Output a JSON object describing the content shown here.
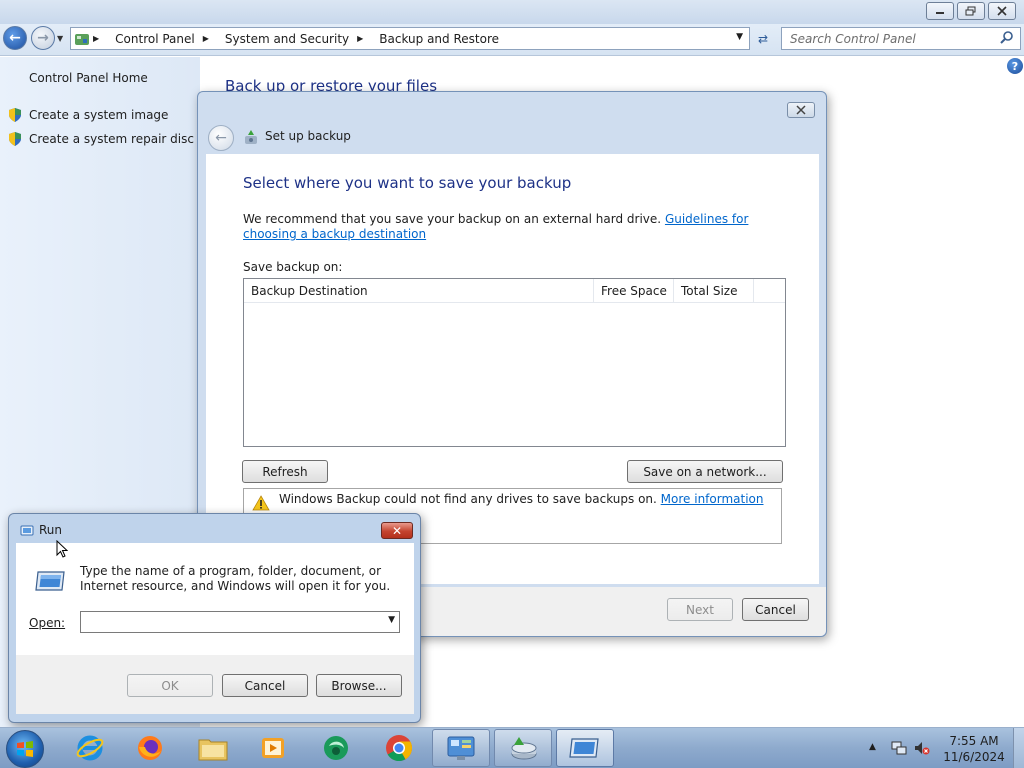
{
  "control_panel": {
    "breadcrumbs": [
      "Control Panel",
      "System and Security",
      "Backup and Restore"
    ],
    "search_placeholder": "Search Control Panel",
    "left_nav": {
      "home": "Control Panel Home",
      "items": [
        "Create a system image",
        "Create a system repair disc"
      ]
    },
    "heading": "Back up or restore your files",
    "caption_buttons": [
      "minimize",
      "restore",
      "close"
    ]
  },
  "backup_dialog": {
    "title": "Set up backup",
    "instruction": "Select where you want to save your backup",
    "recommendation": "We recommend that you save your backup on an external hard drive.",
    "guidelines_link": "Guidelines for choosing a backup destination",
    "save_on_label": "Save backup on:",
    "columns": [
      "Backup Destination",
      "Free Space",
      "Total Size"
    ],
    "rows": [],
    "refresh_button": "Refresh",
    "save_network_button": "Save on a network...",
    "warning_text": "Windows Backup could not find any drives to save backups on.",
    "more_info_link": "More information",
    "next_button": "Next",
    "cancel_button": "Cancel"
  },
  "run_dialog": {
    "title": "Run",
    "description": "Type the name of a program, folder, document, or Internet resource, and Windows will open it for you.",
    "open_label": "Open:",
    "open_value": "",
    "ok_button": "OK",
    "cancel_button": "Cancel",
    "browse_button": "Browse..."
  },
  "taskbar": {
    "pinned": [
      "internet-explorer",
      "firefox",
      "windows-explorer",
      "media-player",
      "app-green",
      "chrome"
    ],
    "open_windows": [
      "control-panel",
      "backup-tool",
      "run-dialog"
    ],
    "time": "7:55 AM",
    "date": "11/6/2024"
  },
  "colors": {
    "heading_blue": "#1e3287",
    "link_blue": "#0066cc",
    "window_frame": "#cfddef",
    "taskbar": "#8eaacd"
  }
}
